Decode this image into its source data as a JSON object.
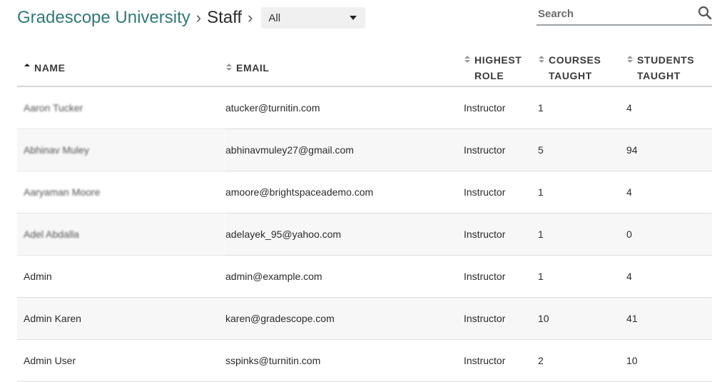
{
  "breadcrumb": {
    "root": "Gradescope University",
    "separator": "›",
    "current": "Staff"
  },
  "filter": {
    "selected": "All"
  },
  "search": {
    "placeholder": "Search"
  },
  "table": {
    "headers": {
      "name": "NAME",
      "email": "EMAIL",
      "role": [
        "HIGHEST",
        "ROLE"
      ],
      "courses": [
        "COURSES",
        "TAUGHT"
      ],
      "students": [
        "STUDENTS",
        "TAUGHT"
      ]
    },
    "rows": [
      {
        "name": "Aaron Tucker",
        "email": "atucker@turnitin.com",
        "role": "Instructor",
        "courses": "1",
        "students": "4"
      },
      {
        "name": "Abhinav Muley",
        "email": "abhinavmuley27@gmail.com",
        "role": "Instructor",
        "courses": "5",
        "students": "94"
      },
      {
        "name": "Aaryaman Moore",
        "email": "amoore@brightspaceademo.com",
        "role": "Instructor",
        "courses": "1",
        "students": "4"
      },
      {
        "name": "Adel Abdalla",
        "email": "adelayek_95@yahoo.com",
        "role": "Instructor",
        "courses": "1",
        "students": "0"
      },
      {
        "name": "Admin",
        "email": "admin@example.com",
        "role": "Instructor",
        "courses": "1",
        "students": "4"
      },
      {
        "name": "Admin Karen",
        "email": "karen@gradescope.com",
        "role": "Instructor",
        "courses": "10",
        "students": "41"
      },
      {
        "name": "Admin User",
        "email": "sspinks@turnitin.com",
        "role": "Instructor",
        "courses": "2",
        "students": "10"
      }
    ]
  },
  "colors": {
    "brand": "#2f7a78",
    "text": "#2b2b2b",
    "row_alt": "#f7f7f7"
  }
}
